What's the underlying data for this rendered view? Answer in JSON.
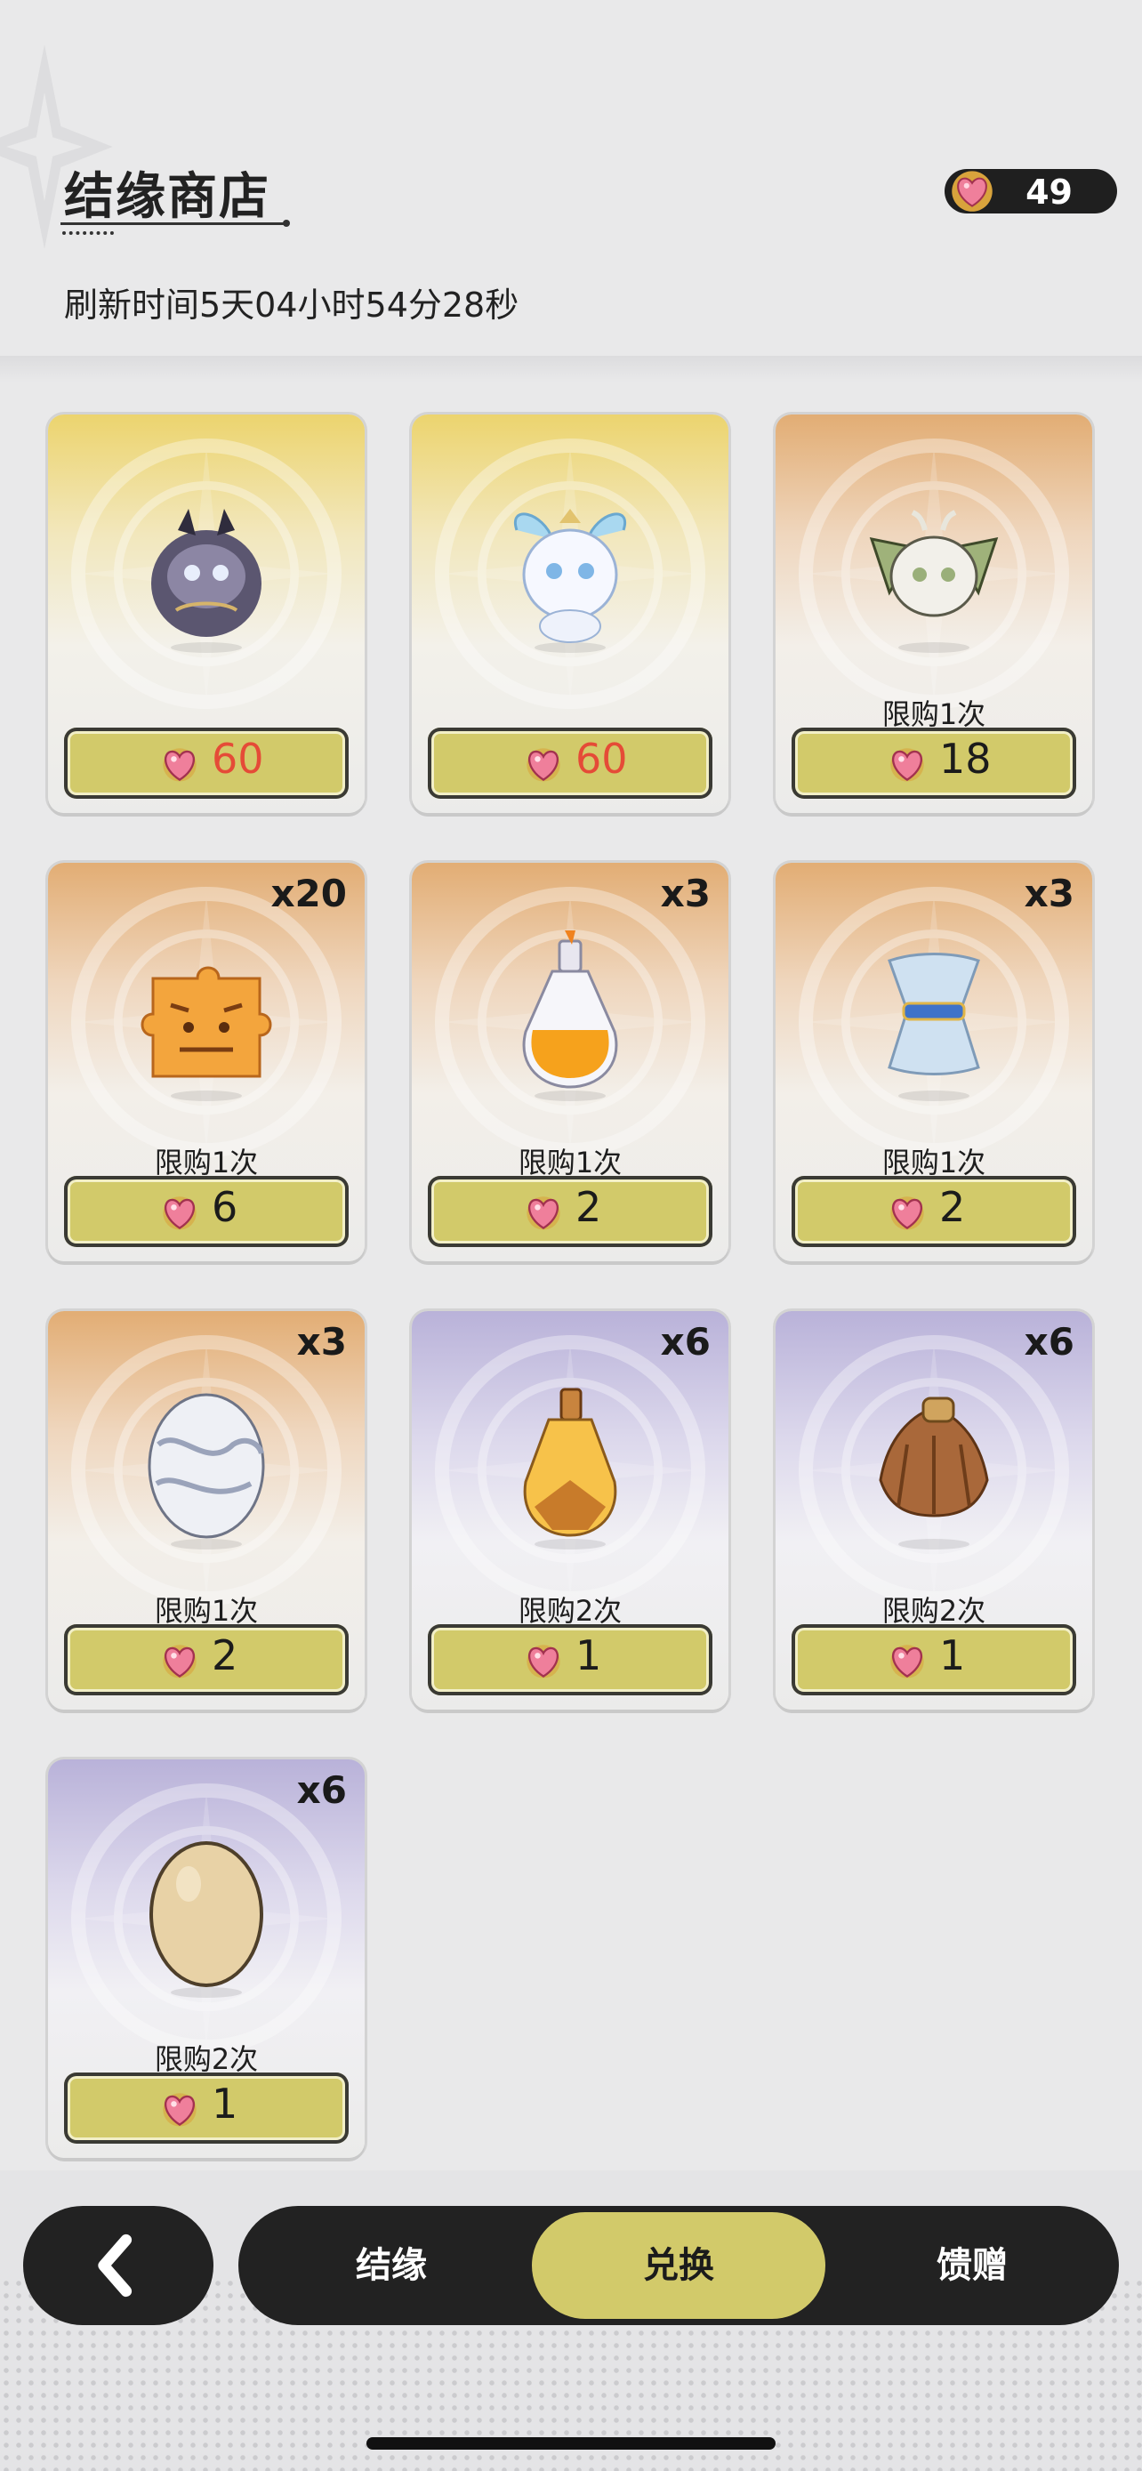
{
  "header": {
    "title": "结缘商店",
    "refresh_text": "刷新时间5天04小时54分28秒",
    "currency_value": "49"
  },
  "shop_items": [
    {
      "qty": "",
      "limit": "",
      "price": "60",
      "price_color": "#e54b37",
      "theme": "gold",
      "icon": "dark-horned-creature-icon"
    },
    {
      "qty": "",
      "limit": "",
      "price": "60",
      "price_color": "#e54b37",
      "theme": "gold",
      "icon": "white-dragon-creature-icon"
    },
    {
      "qty": "",
      "limit": "限购1次",
      "price": "18",
      "price_color": "#1b1b1b",
      "theme": "orange",
      "icon": "leaf-winged-creature-icon"
    },
    {
      "qty": "x20",
      "limit": "限购1次",
      "price": "6",
      "price_color": "#1b1b1b",
      "theme": "orange",
      "icon": "tiger-puzzle-piece-icon"
    },
    {
      "qty": "x3",
      "limit": "限购1次",
      "price": "2",
      "price_color": "#1b1b1b",
      "theme": "orange",
      "icon": "orange-potion-bottle-icon"
    },
    {
      "qty": "x3",
      "limit": "限购1次",
      "price": "2",
      "price_color": "#1b1b1b",
      "theme": "orange",
      "icon": "blue-cloth-bundle-icon"
    },
    {
      "qty": "x3",
      "limit": "限购1次",
      "price": "2",
      "price_color": "#1b1b1b",
      "theme": "orange",
      "icon": "patterned-egg-icon"
    },
    {
      "qty": "x6",
      "limit": "限购2次",
      "price": "1",
      "price_color": "#1b1b1b",
      "theme": "purple",
      "icon": "small-potion-bottle-icon"
    },
    {
      "qty": "x6",
      "limit": "限购2次",
      "price": "1",
      "price_color": "#1b1b1b",
      "theme": "purple",
      "icon": "brown-hair-bundle-icon"
    },
    {
      "qty": "x6",
      "limit": "限购2次",
      "price": "1",
      "price_color": "#1b1b1b",
      "theme": "purple",
      "icon": "plain-egg-icon"
    }
  ],
  "nav": {
    "back_icon": "back-arrow-icon",
    "tabs": [
      "结缘",
      "兑换",
      "馈赠"
    ],
    "active_tab": "兑换"
  }
}
